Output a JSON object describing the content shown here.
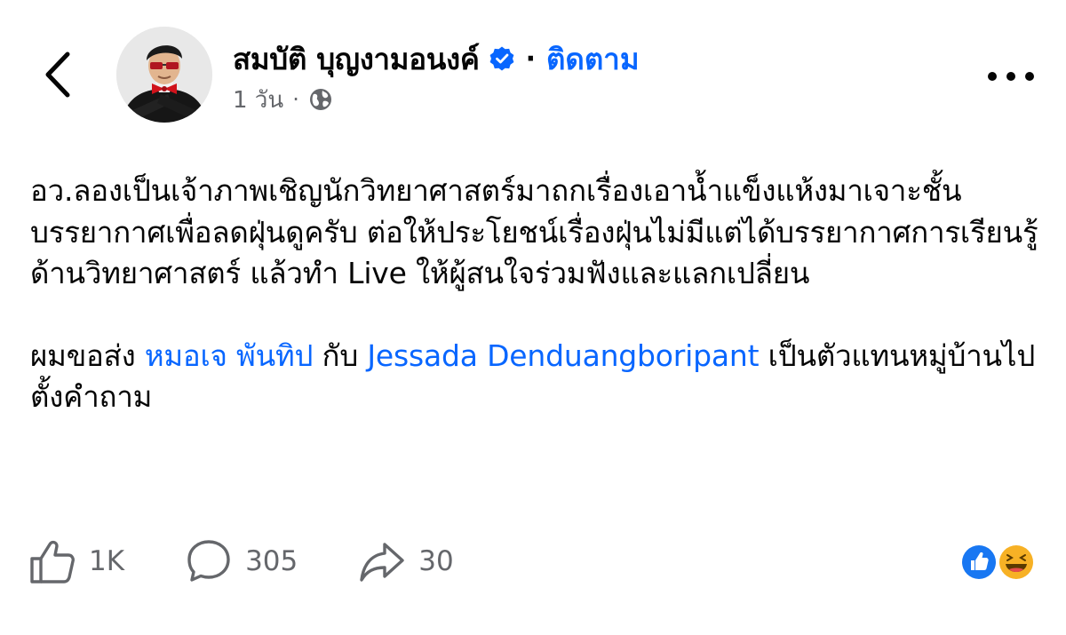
{
  "header": {
    "back_icon": "chevron-left-icon",
    "author_name": "สมบัติ บุญงามอนงค์",
    "verified_icon": "verified-badge-icon",
    "separator": "·",
    "follow_label": "ติดตาม",
    "time": "1 วัน",
    "meta_separator": "·",
    "audience_icon": "globe-icon",
    "more_icon": "more-horizontal-icon"
  },
  "post": {
    "paragraph1": "อว.ลองเป็นเจ้าภาพเชิญนักวิทยาศาสตร์มาถกเรื่องเอาน้ำแข็งแห้งมาเจาะชั้นบรรยากาศเพื่อลดฝุ่นดูครับ ต่อให้ประโยชน์เรื่องฝุ่นไม่มีแต่ได้บรรยากาศการเรียนรู้ด้านวิทยาศาสตร์ แล้วทำ Live ให้ผู้สนใจร่วมฟังและแลกเปลี่ยน",
    "p2_prefix": "ผมขอส่ง ",
    "mention1": "หมอเจ พันทิป",
    "p2_middle": " กับ ",
    "mention2": "Jessada Denduangboripant",
    "p2_suffix": " เป็นตัวแทนหมู่บ้านไปตั้งคำถาม"
  },
  "actions": {
    "like": {
      "icon": "thumbs-up-icon",
      "count": "1K"
    },
    "comment": {
      "icon": "comment-bubble-icon",
      "count": "305"
    },
    "share": {
      "icon": "share-arrow-icon",
      "count": "30"
    }
  },
  "reactions": [
    "like-reaction-icon",
    "haha-reaction-icon"
  ],
  "colors": {
    "link": "#0866ff",
    "text": "#050505",
    "muted": "#65676b",
    "haha": "#f7b125"
  }
}
